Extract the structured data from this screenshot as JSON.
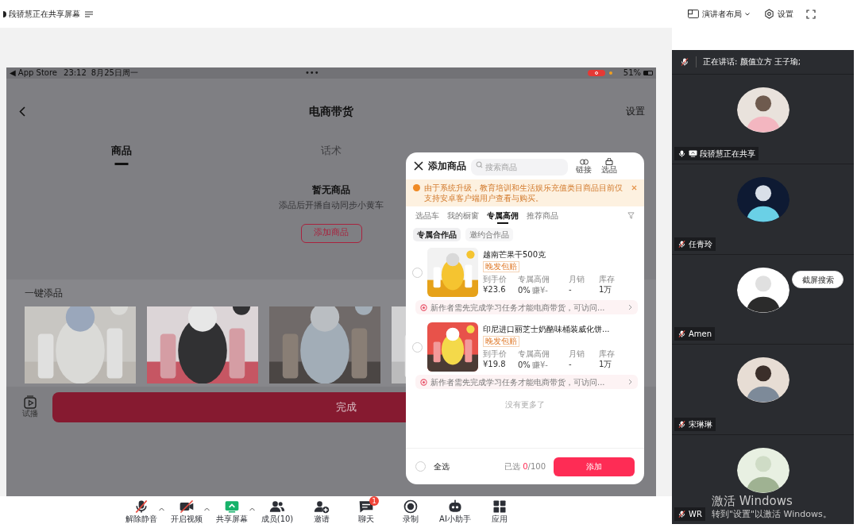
{
  "top_bar": {
    "sharing_text": "段骄慧正在共享屏幕",
    "layout_button": "演讲者布局",
    "settings_button": "设置"
  },
  "phone": {
    "status_bar": {
      "back_app": "◀ App Store",
      "time": "23:12",
      "date": "8月25日周一",
      "dots": "•••",
      "battery": "51%"
    },
    "title": "电商带货",
    "settings": "设置",
    "tabs": [
      {
        "label": "商品",
        "selected": true
      },
      {
        "label": "话术",
        "selected": false
      }
    ],
    "empty_state": {
      "title": "暂无商品",
      "subtitle": "添品后开播自动同步小黄车",
      "button": "添加商品"
    },
    "quick_add": {
      "title": "一键添品"
    },
    "trial_label": "试播",
    "done_button": "完成",
    "modal": {
      "title": "添加商品",
      "search_placeholder": "搜索商品",
      "link_label": "链接",
      "select_label": "选品",
      "notice": "由于系统升级，教育培训和生活娱乐充值类目商品目前仅支持安卓客户端用户查看与购买。",
      "tabs": [
        {
          "label": "选品车",
          "selected": false
        },
        {
          "label": "我的橱窗",
          "selected": false
        },
        {
          "label": "专属高佣",
          "selected": true
        },
        {
          "label": "推荐商品",
          "selected": false
        }
      ],
      "chips": [
        {
          "label": "专属合作品",
          "selected": true
        },
        {
          "label": "邀约合作品",
          "selected": false
        }
      ],
      "products": [
        {
          "checked": false,
          "title": "越南芒果干500克",
          "tag": "晚发包赔",
          "price_label": "到手价",
          "price": "¥23.6",
          "commission_label": "专属高佣",
          "commission": "0%",
          "earn": "赚¥-",
          "sales_label": "月销",
          "sales": "-",
          "stock_label": "库存",
          "stock": "1万",
          "notice": "新作者需先完成学习任务才能电商带货，可访问..."
        },
        {
          "checked": false,
          "title": "印尼进口丽芝士奶酪味桶装威化饼...",
          "tag": "晚发包赔",
          "price_label": "到手价",
          "price": "¥19.8",
          "commission_label": "专属高佣",
          "commission": "0%",
          "earn": "赚¥-",
          "sales_label": "月销",
          "sales": "-",
          "stock_label": "库存",
          "stock": "1万",
          "notice": "新作者需先完成学习任务才能电商带货，可访问..."
        }
      ],
      "end_text": "没有更多了",
      "select_all": {
        "label": "全选",
        "checked": false
      },
      "selected_prefix": "已选",
      "selected_count": "0",
      "selected_total": "/100",
      "add_button": "添加"
    }
  },
  "toolbar": [
    {
      "label": "解除静音",
      "kind": "mic",
      "caret": true
    },
    {
      "label": "开启视频",
      "kind": "video",
      "caret": true
    },
    {
      "label": "共享屏幕",
      "kind": "share",
      "caret": true
    },
    {
      "label": "成员(10)",
      "kind": "members",
      "caret": false
    },
    {
      "label": "邀请",
      "kind": "invite",
      "caret": false
    },
    {
      "label": "聊天",
      "kind": "chat",
      "caret": false,
      "badge": "1"
    },
    {
      "label": "录制",
      "kind": "record",
      "caret": false
    },
    {
      "label": "AI小助手",
      "kind": "ai",
      "caret": false
    },
    {
      "label": "应用",
      "kind": "apps",
      "caret": false
    }
  ],
  "participants": {
    "speaking": "正在讲话: 颜值立方 王子瑜;",
    "tiles": [
      {
        "name": "段骄慧正在共享",
        "muted": false,
        "sharing": true
      },
      {
        "name": "任青玲",
        "muted": true,
        "sharing": false
      },
      {
        "name": "Amen",
        "muted": true,
        "sharing": false
      },
      {
        "name": "宋琳琳",
        "muted": true,
        "sharing": false
      },
      {
        "name": "WR",
        "muted": true,
        "sharing": false
      }
    ]
  },
  "screenshot_search": "截屏搜索",
  "os_notice": {
    "title": "激活 Windows",
    "subtitle": "转到\"设置\"以激活 Windows。"
  }
}
